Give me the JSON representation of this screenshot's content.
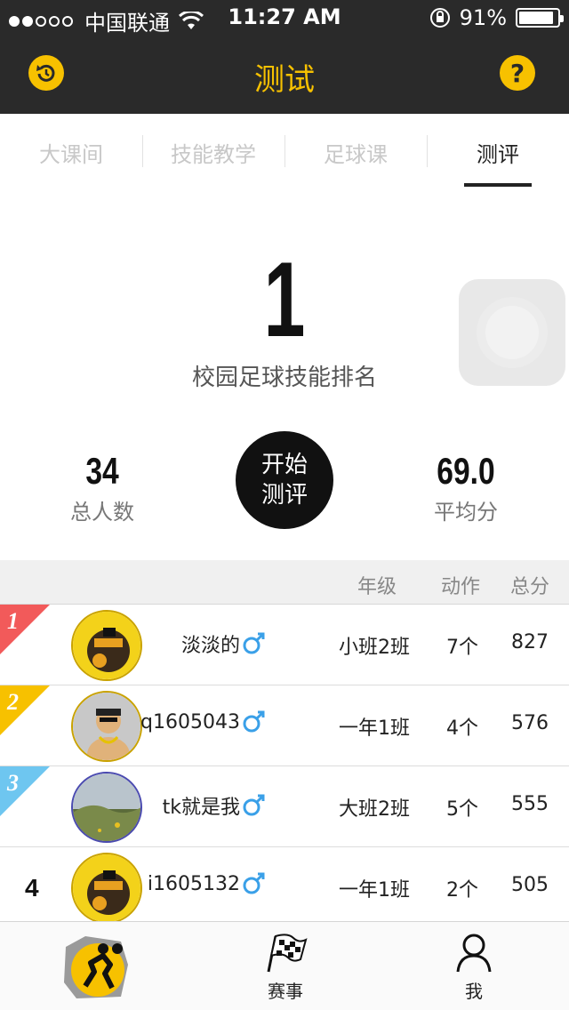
{
  "status_bar": {
    "carrier": "中国联通",
    "time": "11:27 AM",
    "battery_percent": "91%",
    "battery_level": 0.91,
    "signal_bars_filled": 2,
    "signal_bars_total": 5
  },
  "nav": {
    "title": "测试",
    "left_icon": "refresh-icon",
    "right_icon": "help-icon",
    "right_label": "?"
  },
  "tabs": [
    {
      "label": "大课间",
      "active": false
    },
    {
      "label": "技能教学",
      "active": false
    },
    {
      "label": "足球课",
      "active": false
    },
    {
      "label": "测评",
      "active": true
    }
  ],
  "summary": {
    "rank": "1",
    "rank_label": "校园足球技能排名",
    "total_value": "34",
    "total_label": "总人数",
    "avg_value": "69.0",
    "avg_label": "平均分",
    "start_line1": "开始",
    "start_line2": "测评"
  },
  "table": {
    "headers": {
      "grade": "年级",
      "action": "动作",
      "score": "总分"
    },
    "rows": [
      {
        "rank": "1",
        "name": "淡淡的",
        "grade": "小班2班",
        "actions": "7个",
        "score": "827"
      },
      {
        "rank": "2",
        "name": "q1605043",
        "grade": "一年1班",
        "actions": "4个",
        "score": "576"
      },
      {
        "rank": "3",
        "name": "tk就是我",
        "grade": "大班2班",
        "actions": "5个",
        "score": "555"
      },
      {
        "rank": "4",
        "name": "i1605132",
        "grade": "一年1班",
        "actions": "2个",
        "score": "505"
      }
    ]
  },
  "tabbar": {
    "race_label": "赛事",
    "me_label": "我"
  },
  "colors": {
    "accent": "#f7c100",
    "nav_bg": "#2a2a2a",
    "rank1": "#f25a5a",
    "rank2": "#f7c100",
    "rank3": "#6ec6f0",
    "male": "#3aa0e8"
  }
}
